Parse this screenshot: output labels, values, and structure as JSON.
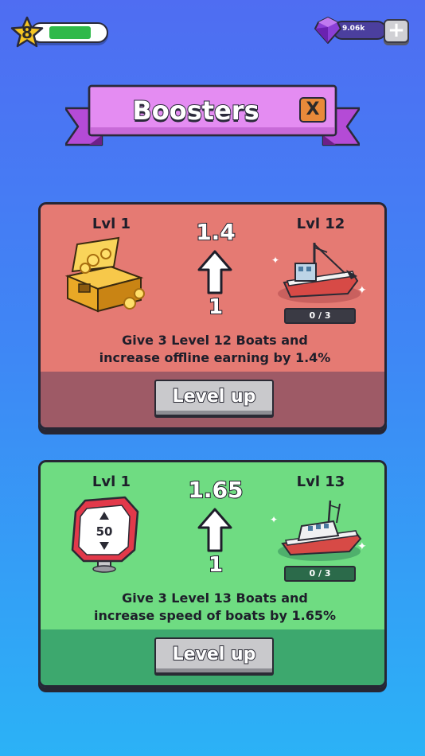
{
  "hud": {
    "player_level": "8",
    "xp_progress_fraction": 0.72,
    "gems": "9.06k",
    "add_button": "+"
  },
  "header": {
    "title": "Boosters",
    "close_label": "X"
  },
  "boosters": [
    {
      "level_label": "Lvl 1",
      "value_next": "1.4",
      "value_current": "1",
      "boat_level_label": "Lvl 12",
      "progress": "0 / 3",
      "description_line1": "Give 3 Level 12 Boats and",
      "description_line2": "increase offline earning by 1.4%",
      "button_label": "Level up",
      "icon": "treasure-chest",
      "colors": {
        "top": "#e57a73",
        "bottom": "#9e5a66"
      }
    },
    {
      "level_label": "Lvl 1",
      "value_next": "1.65",
      "value_current": "1",
      "boat_level_label": "Lvl 13",
      "progress": "0 / 3",
      "description_line1": "Give 3 Level 13 Boats and",
      "description_line2": "increase speed of boats by 1.65%",
      "button_label": "Level up",
      "icon": "speed-limit-sign",
      "sign_text": "50",
      "colors": {
        "top": "#6fdc82",
        "bottom": "#3da86e"
      }
    }
  ]
}
